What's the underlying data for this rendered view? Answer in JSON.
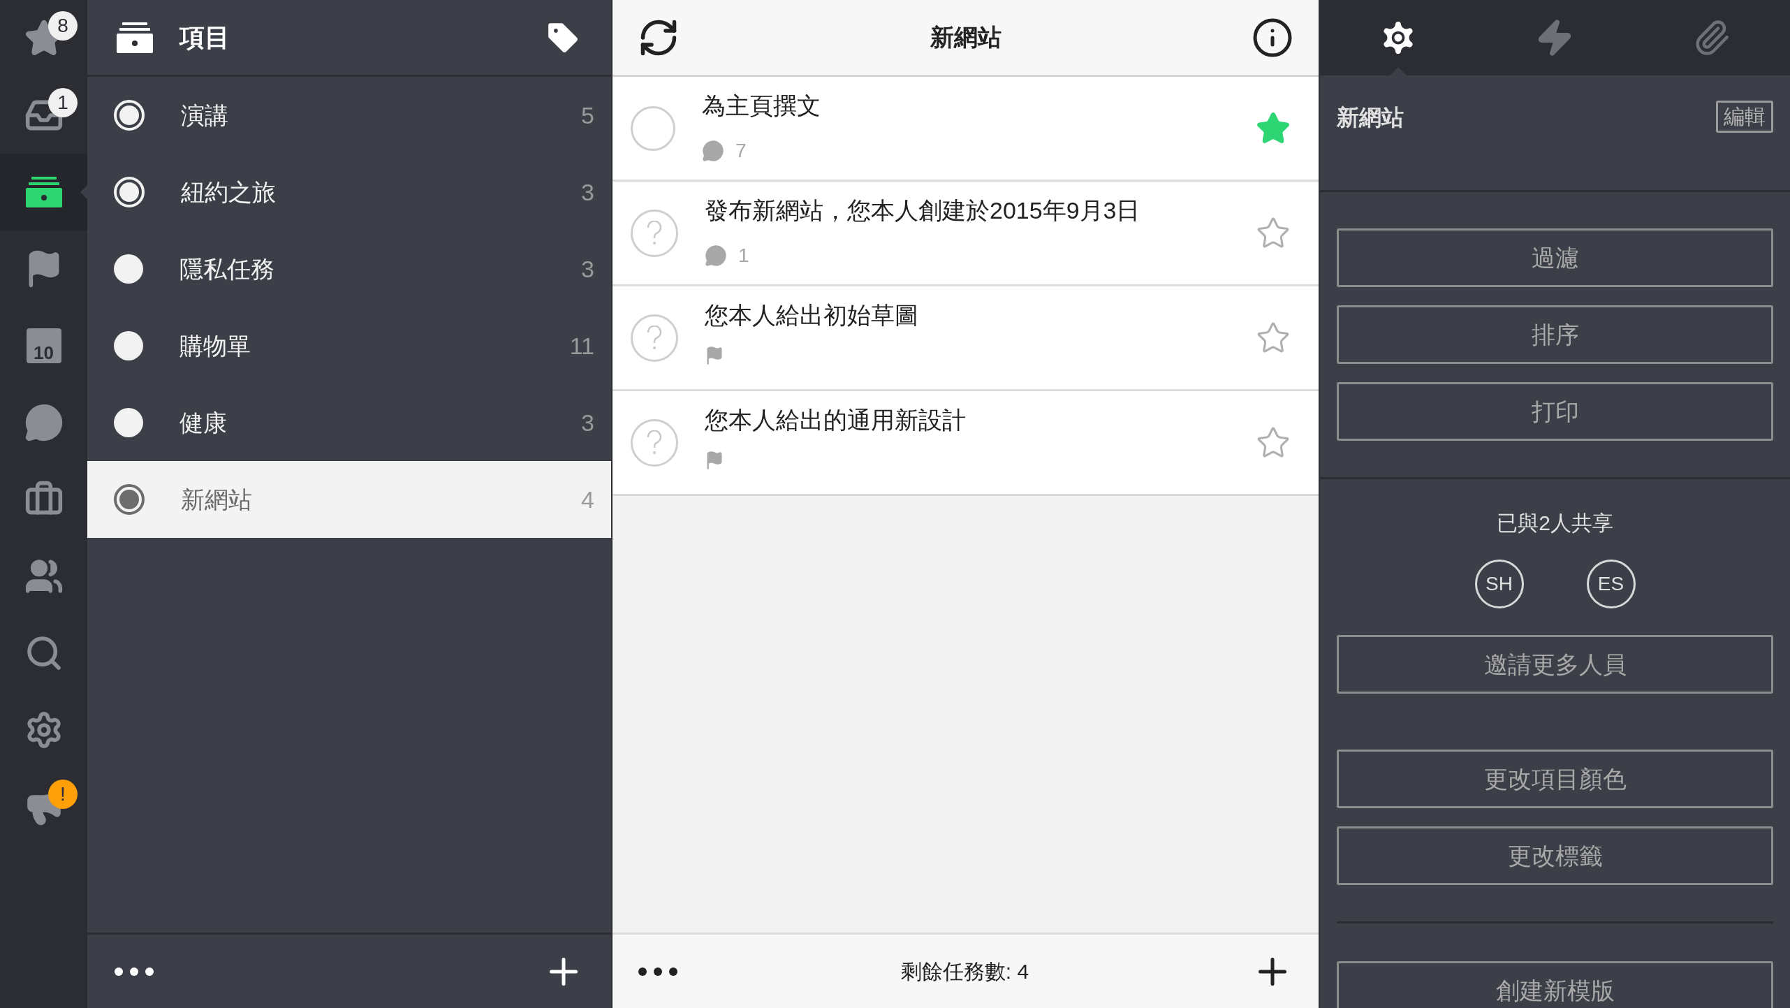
{
  "rail": [
    {
      "kind": "star",
      "badge": "8",
      "selected": false
    },
    {
      "kind": "inbox",
      "badge": "1",
      "selected": false
    },
    {
      "kind": "projects",
      "selected": true
    },
    {
      "kind": "flag",
      "selected": false
    },
    {
      "kind": "calendar",
      "day": "10",
      "selected": false
    },
    {
      "kind": "chat",
      "selected": false
    },
    {
      "kind": "briefcase",
      "selected": false
    },
    {
      "kind": "people",
      "selected": false
    },
    {
      "kind": "search",
      "selected": false
    },
    {
      "kind": "settings",
      "selected": false
    },
    {
      "kind": "megaphone",
      "badge": "!",
      "selected": false
    }
  ],
  "projects_panel": {
    "title": "項目",
    "items": [
      {
        "name": "演講",
        "count": "5",
        "kind": "ring",
        "selected": false
      },
      {
        "name": "紐約之旅",
        "count": "3",
        "kind": "ring",
        "selected": false
      },
      {
        "name": "隱私任務",
        "count": "3",
        "kind": "solid",
        "selected": false
      },
      {
        "name": "購物單",
        "count": "11",
        "kind": "solid",
        "selected": false
      },
      {
        "name": "健康",
        "count": "3",
        "kind": "solid",
        "selected": false
      },
      {
        "name": "新網站",
        "count": "4",
        "kind": "ring",
        "selected": true
      }
    ]
  },
  "task_list": {
    "title": "新網站",
    "tasks": [
      {
        "title": "為主頁撰文",
        "kind": "open",
        "checked": false,
        "starred": true,
        "meta": {
          "kind": "comments",
          "count": "7"
        }
      },
      {
        "title": "發布新網站，您本人創建於2015年9月3日",
        "kind": "question",
        "checked": false,
        "starred": false,
        "meta": {
          "kind": "comments",
          "count": "1"
        }
      },
      {
        "title": "您本人給出初始草圖",
        "kind": "question",
        "checked": false,
        "starred": false,
        "meta": {
          "kind": "flag"
        }
      },
      {
        "title": "您本人給出的通用新設計",
        "kind": "question",
        "checked": false,
        "starred": false,
        "meta": {
          "kind": "flag"
        }
      }
    ],
    "footer": "剩餘任務數: 4"
  },
  "details": {
    "tabs": [
      {
        "kind": "settings",
        "selected": true
      },
      {
        "kind": "activity",
        "selected": false
      },
      {
        "kind": "attachments",
        "selected": false
      }
    ],
    "title": "新網站",
    "edit": "編輯",
    "actions": [
      "過濾",
      "排序",
      "打印"
    ],
    "shared_label": "已與2人共享",
    "people": [
      "SH",
      "ES"
    ],
    "invite": "邀請更多人員",
    "more_actions": [
      "更改項目顏色",
      "更改標籤"
    ],
    "template": "創建新模版"
  }
}
